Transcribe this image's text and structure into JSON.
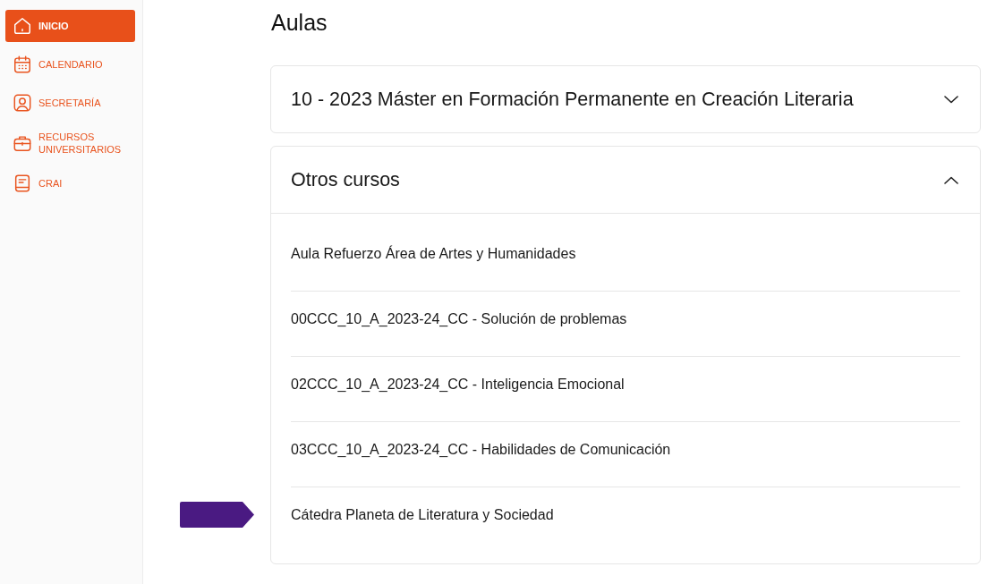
{
  "sidebar": {
    "items": [
      {
        "kind": "home",
        "label": "INICIO",
        "selected": true
      },
      {
        "kind": "calendar",
        "label": "CALENDARIO",
        "selected": false
      },
      {
        "kind": "profile",
        "label": "SECRETARÍA",
        "selected": false
      },
      {
        "kind": "briefcase",
        "label": "RECURSOS UNIVERSITARIOS",
        "selected": false
      },
      {
        "kind": "document",
        "label": "CRAI",
        "selected": false
      }
    ]
  },
  "page_title": "Aulas",
  "sections": [
    {
      "title": "10 - 2023 Máster en Formación Permanente en Creación Literaria",
      "expanded": false
    },
    {
      "title": "Otros cursos",
      "expanded": true,
      "courses": [
        {
          "name": "Aula Refuerzo Área de Artes y Humanidades",
          "marked": false
        },
        {
          "name": "00CCC_10_A_2023-24_CC - Solución de problemas",
          "marked": false
        },
        {
          "name": "02CCC_10_A_2023-24_CC - Inteligencia Emocional",
          "marked": false
        },
        {
          "name": "03CCC_10_A_2023-24_CC - Habilidades de Comunicación",
          "marked": false
        },
        {
          "name": "Cátedra Planeta de Literatura y Sociedad",
          "marked": true
        }
      ]
    }
  ]
}
